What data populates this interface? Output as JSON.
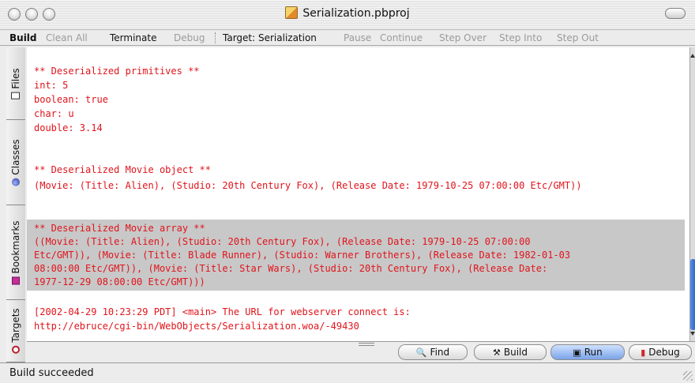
{
  "window": {
    "title": "Serialization.pbproj"
  },
  "toolbar": {
    "build": "Build",
    "clean_all": "Clean All",
    "terminate": "Terminate",
    "debug": "Debug",
    "target": "Target: Serialization",
    "pause": "Pause",
    "continue": "Continue",
    "step_over": "Step Over",
    "step_into": "Step Into",
    "step_out": "Step Out"
  },
  "side_tabs": {
    "files": "Files",
    "classes": "Classes",
    "bookmarks": "Bookmarks",
    "targets": "Targets"
  },
  "log_lines": [
    "** Deserialized primitives **",
    "int: 5",
    "boolean: true",
    "char: u",
    "double: 3.14",
    "** Deserialized Movie object **",
    "(Movie: (Title: Alien), (Studio: 20th Century Fox), (Release Date: 1979-10-25 07:00:00 Etc/GMT))",
    "** Deserialized Movie array **",
    "((Movie: (Title: Alien), (Studio: 20th Century Fox), (Release Date: 1979-10-25 07:00:00",
    "Etc/GMT)), (Movie: (Title: Blade Runner), (Studio: Warner Brothers), (Release Date: 1982-01-03",
    "08:00:00 Etc/GMT)), (Movie: (Title: Star Wars), (Studio: 20th Century Fox), (Release Date:",
    "1977-12-29 08:00:00 Etc/GMT)))",
    "[2002-04-29 10:23:29 PDT] <main> The URL for webserver connect is:",
    "http://ebruce/cgi-bin/WebObjects/Serialization.woa/-49430"
  ],
  "buttons": {
    "find": "Find",
    "build": "Build",
    "run": "Run",
    "debug": "Debug"
  },
  "status": {
    "text": "Build succeeded"
  },
  "colors": {
    "log_text": "#e0141b",
    "selection": "#c8c8c8"
  }
}
